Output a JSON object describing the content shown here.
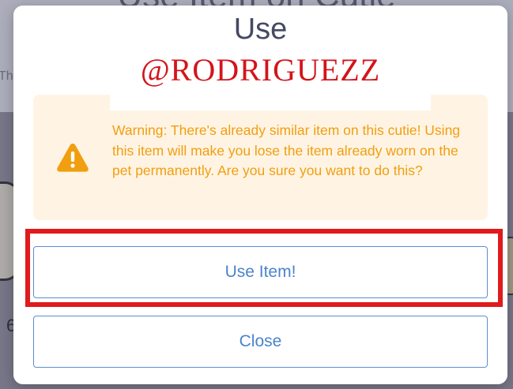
{
  "background": {
    "title": "Use Item on Cutie",
    "side_text": "Th",
    "left_number": "6"
  },
  "modal": {
    "title": "Use",
    "signature": "@RODRIGUEZZ",
    "warning": {
      "icon": "warning-triangle-icon",
      "text": "Warning: There's already similar item on this cutie! Using this item will make you lose the item already worn on the pet permanently. Are you sure you want to do this?"
    },
    "use_button_label": "Use Item!",
    "close_button_label": "Close"
  },
  "colors": {
    "accent_blue": "#4a84cc",
    "warning_orange": "#f19e0f",
    "warning_bg": "#fff4e4",
    "highlight_red": "#e01a1d",
    "title_text": "#454963"
  }
}
